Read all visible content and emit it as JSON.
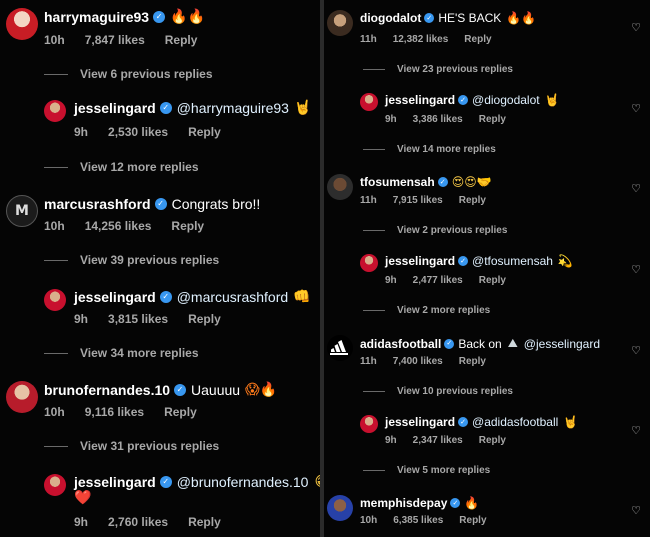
{
  "left": {
    "c1": {
      "user": "harrymaguire93",
      "emoji": "🔥🔥",
      "time": "10h",
      "likes": "7,847 likes",
      "reply": "Reply"
    },
    "v1": "View 6 previous replies",
    "c2": {
      "user": "jesselingard",
      "mention": "@harrymaguire93",
      "emoji": "🤘",
      "time": "9h",
      "likes": "2,530 likes",
      "reply": "Reply"
    },
    "v2": "View 12 more replies",
    "c3": {
      "user": "marcusrashford",
      "text": "Congrats bro!!",
      "time": "10h",
      "likes": "14,256 likes",
      "reply": "Reply"
    },
    "v3": "View 39 previous replies",
    "c4": {
      "user": "jesselingard",
      "mention": "@marcusrashford",
      "emoji": "👊",
      "time": "9h",
      "likes": "3,815 likes",
      "reply": "Reply"
    },
    "v4": "View 34 more replies",
    "c5": {
      "user": "brunofernandes.10",
      "text": "Uauuuu",
      "emoji": "😱🔥",
      "time": "10h",
      "likes": "9,116 likes",
      "reply": "Reply"
    },
    "v5": "View 31 previous replies",
    "c6": {
      "user": "jesselingard",
      "mention": "@brunofernandes.10",
      "emoji": "😁",
      "emoji2": "❤️",
      "time": "9h",
      "likes": "2,760 likes",
      "reply": "Reply"
    }
  },
  "right": {
    "c1": {
      "user": "diogodalot",
      "text": "HE'S BACK",
      "emoji": "🔥🔥",
      "time": "11h",
      "likes": "12,382 likes",
      "reply": "Reply"
    },
    "v1": "View 23 previous replies",
    "c2": {
      "user": "jesselingard",
      "mention": "@diogodalot",
      "emoji": "🤘",
      "time": "9h",
      "likes": "3,386 likes",
      "reply": "Reply"
    },
    "v2": "View 14 more replies",
    "c3": {
      "user": "tfosumensah",
      "emoji": "😍😍🤝",
      "time": "11h",
      "likes": "7,915 likes",
      "reply": "Reply"
    },
    "v3": "View 2 previous replies",
    "c4": {
      "user": "jesselingard",
      "mention": "@tfosumensah",
      "emoji": "💫",
      "time": "9h",
      "likes": "2,477 likes",
      "reply": "Reply"
    },
    "v4": "View 2 more replies",
    "c5": {
      "user": "adidasfootball",
      "text": "Back on",
      "emoji": "⛰",
      "mention": "@jesselingard",
      "time": "11h",
      "likes": "7,400 likes",
      "reply": "Reply"
    },
    "v5": "View 10 previous replies",
    "c6": {
      "user": "jesselingard",
      "mention": "@adidasfootball",
      "emoji": "🤘",
      "time": "9h",
      "likes": "2,347 likes",
      "reply": "Reply"
    },
    "v6": "View 5 more replies",
    "c7": {
      "user": "memphisdepay",
      "emoji": "🔥",
      "time": "10h",
      "likes": "6,385 likes",
      "reply": "Reply"
    }
  },
  "icons": {
    "verified": "verified-badge",
    "like": "heart-outline-icon"
  },
  "colors": {
    "background": "#000000",
    "verified": "#3897f0",
    "meta": "#a8a8a8"
  }
}
